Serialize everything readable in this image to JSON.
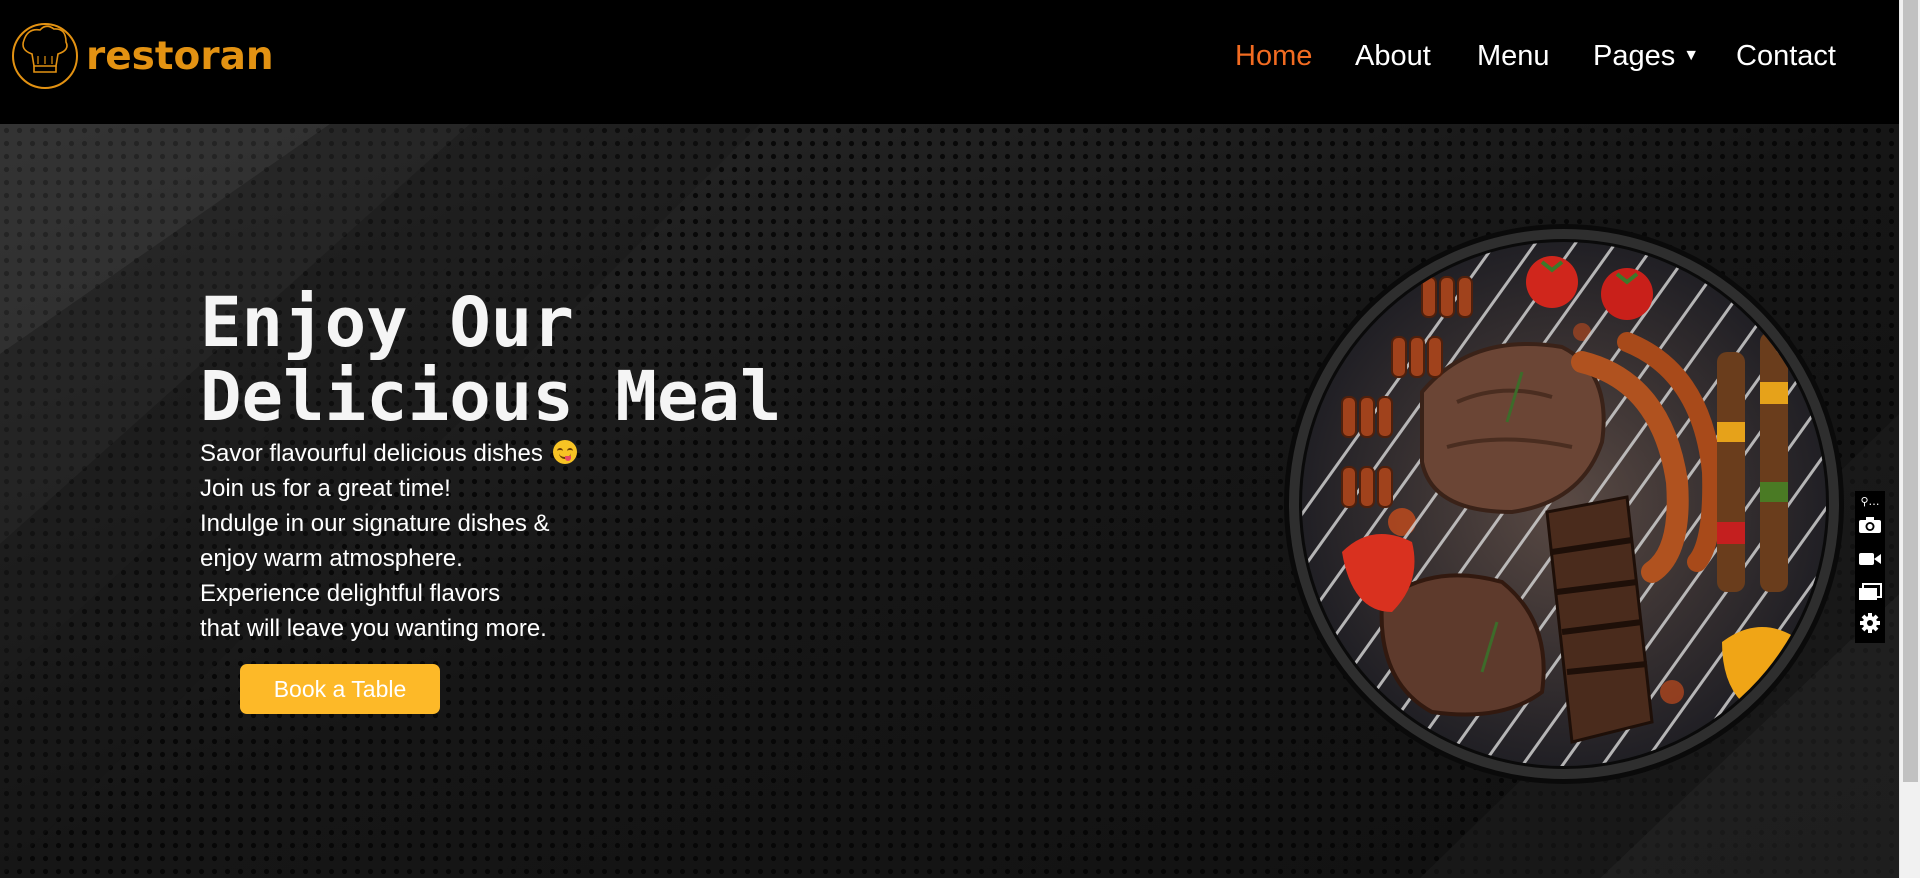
{
  "brand": {
    "name": "restoran",
    "color": "#e39212"
  },
  "nav": {
    "items": [
      {
        "label": "Home",
        "active": true
      },
      {
        "label": "About",
        "active": false
      },
      {
        "label": "Menu",
        "active": false
      },
      {
        "label": "Pages",
        "active": false,
        "dropdown": true
      },
      {
        "label": "Contact",
        "active": false
      }
    ],
    "active_color": "#f26b21",
    "caret": "▼"
  },
  "hero": {
    "title_line1": "Enjoy Our",
    "title_line2": "Delicious Meal",
    "lines": [
      "Savor flavourful delicious dishes",
      "Join us for a great time!",
      "Indulge in our signature dishes &",
      "enjoy warm atmosphere.",
      "Experience delightful flavors",
      "that will leave you wanting more."
    ],
    "emoji_icon": "savoring-food-face-emoji",
    "cta_label": "Book a Table",
    "cta_color": "#fdb928",
    "image_icon": "grill-with-meat-image"
  },
  "side_tools": [
    "camera-icon",
    "video-icon",
    "windows-icon",
    "gear-icon"
  ]
}
